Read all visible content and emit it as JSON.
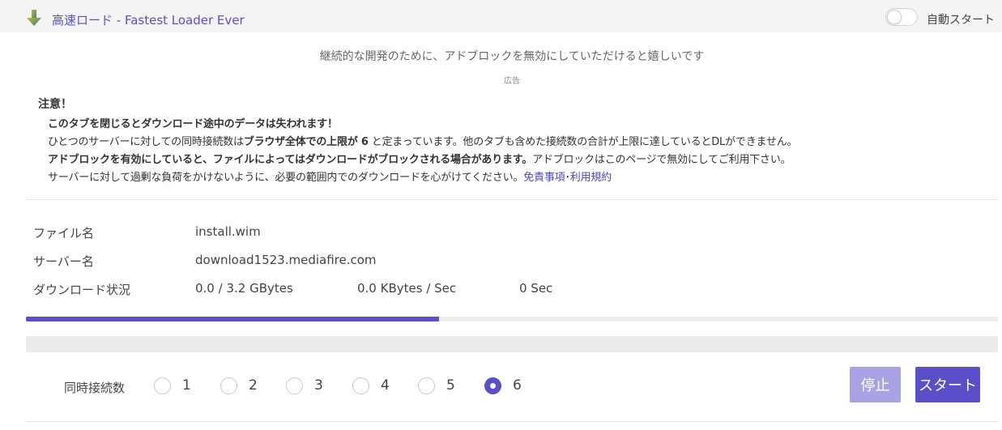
{
  "header": {
    "title": "高速ロード - Fastest Loader Ever",
    "auto_start_label": "自動スタート",
    "auto_start_on": false
  },
  "ad": {
    "message": "継続的な開発のために、アドブロックを無効にしていただけると嬉しいです",
    "label": "広告"
  },
  "notice": {
    "title": "注意！",
    "line1": "このタブを閉じるとダウンロード途中のデータは失われます！",
    "line2_a": "ひとつのサーバーに対しての同時接続数は",
    "line2_b": "ブラウザ全体での上限が 6",
    "line2_c": " と定まっています。他のタブも含めた接続数の合計が上限に達しているとDLができません。",
    "line3_a": "アドブロックを有効にしていると、ファイルによってはダウンロードがブロックされる場合があります。",
    "line3_b": "アドブロックはこのページで無効にしてご利用下さい。",
    "line4_a": "サーバーに対して過剰な負荷をかけないように、必要の範囲内でのダウンロードを心がけてください。",
    "line4_link1": "免責事項",
    "line4_sep": "･",
    "line4_link2": "利用規約"
  },
  "file_info": {
    "filename_label": "ファイル名",
    "filename": "install.wim",
    "server_label": "サーバー名",
    "server": "download1523.mediafire.com",
    "status_label": "ダウンロード状況",
    "size": "0.0 / 3.2 GBytes",
    "speed": "0.0 KBytes / Sec",
    "elapsed": "0 Sec"
  },
  "progress": {
    "fraction": 0.425
  },
  "connections": {
    "label": "同時接続数",
    "options": [
      "1",
      "2",
      "3",
      "4",
      "5",
      "6"
    ],
    "selected": "6"
  },
  "buttons": {
    "stop": "停止",
    "start": "スタート"
  },
  "colors": {
    "accent": "#5b4fc9",
    "accent_disabled": "#a9a3e6",
    "header_bg": "#f4f4f5"
  }
}
